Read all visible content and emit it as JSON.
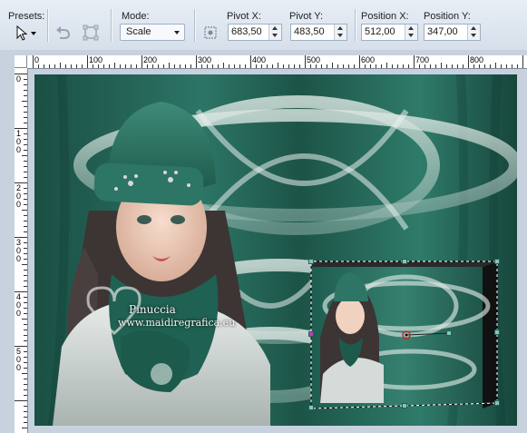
{
  "toolbar": {
    "presets_label": "Presets:",
    "mode_label": "Mode:",
    "mode_value": "Scale",
    "pivot_x_label": "Pivot X:",
    "pivot_x_value": "683,50",
    "pivot_y_label": "Pivot Y:",
    "pivot_y_value": "483,50",
    "position_x_label": "Position X:",
    "position_x_value": "512,00",
    "position_y_label": "Position Y:",
    "position_y_value": "347,00"
  },
  "ruler": {
    "top_labels": [
      "0",
      "100",
      "200",
      "300",
      "400",
      "500",
      "600",
      "700",
      "800"
    ],
    "left_labels": [
      "0",
      "100",
      "200",
      "300",
      "400",
      "500"
    ]
  },
  "watermark": {
    "line1": "Pinuccia",
    "line2": "www.maidiregrafica.eu"
  },
  "colors": {
    "canvas_bg": "#1f5a4c",
    "selection_handle": "#7fc8bd",
    "toolbar_bg": "#e0e7f0"
  },
  "icons": [
    "pick-tool-icon",
    "undo-icon",
    "transform-icon",
    "pivot-icon"
  ]
}
